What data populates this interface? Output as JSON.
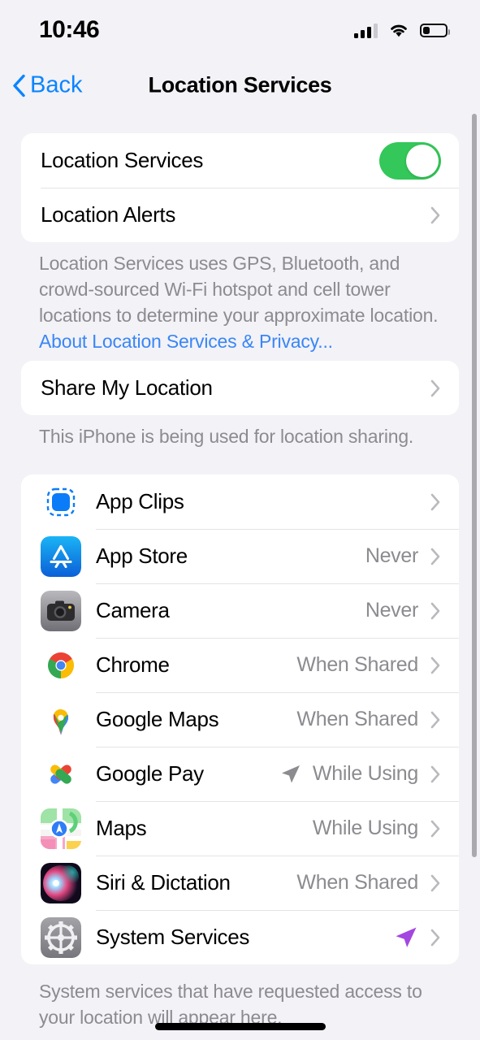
{
  "status_bar": {
    "time": "10:46",
    "cellular_icon": "signal-bars-icon",
    "wifi_icon": "wifi-icon",
    "battery_icon": "battery-icon",
    "battery_level_pct": 28
  },
  "nav": {
    "back_label": "Back",
    "back_icon": "chevron-left-icon",
    "title": "Location Services"
  },
  "colors": {
    "accent_blue": "#0a84ff",
    "link_blue": "#3a86f5",
    "toggle_green": "#34c759",
    "value_gray": "#8b8b90",
    "background": "#f2f2f7",
    "card": "#ffffff",
    "system_services_arrow": "#a347e0",
    "location_arrow_gray": "#8b8b90"
  },
  "section_main": {
    "rows": [
      {
        "label": "Location Services",
        "control": "toggle",
        "toggle_on": true
      },
      {
        "label": "Location Alerts",
        "control": "chevron"
      }
    ],
    "note_text": "Location Services uses GPS, Bluetooth, and crowd-sourced Wi-Fi hotspot and cell tower locations to determine your approximate location. ",
    "note_link": "About Location Services & Privacy..."
  },
  "section_share": {
    "rows": [
      {
        "label": "Share My Location",
        "control": "chevron"
      }
    ],
    "note_text": "This iPhone is being used for location sharing."
  },
  "section_apps": {
    "rows": [
      {
        "label": "App Clips",
        "value": "",
        "icon": "app-clips-icon",
        "indicator": ""
      },
      {
        "label": "App Store",
        "value": "Never",
        "icon": "app-store-icon",
        "indicator": ""
      },
      {
        "label": "Camera",
        "value": "Never",
        "icon": "camera-icon",
        "indicator": ""
      },
      {
        "label": "Chrome",
        "value": "When Shared",
        "icon": "chrome-icon",
        "indicator": ""
      },
      {
        "label": "Google Maps",
        "value": "When Shared",
        "icon": "google-maps-icon",
        "indicator": ""
      },
      {
        "label": "Google Pay",
        "value": "While Using",
        "icon": "google-pay-icon",
        "indicator": "location-arrow-gray-icon"
      },
      {
        "label": "Maps",
        "value": "While Using",
        "icon": "apple-maps-icon",
        "indicator": ""
      },
      {
        "label": "Siri & Dictation",
        "value": "When Shared",
        "icon": "siri-icon",
        "indicator": ""
      },
      {
        "label": "System Services",
        "value": "",
        "icon": "system-services-icon",
        "indicator": "location-arrow-purple-icon"
      }
    ],
    "note_text": "System services that have requested access to your location will appear here."
  }
}
